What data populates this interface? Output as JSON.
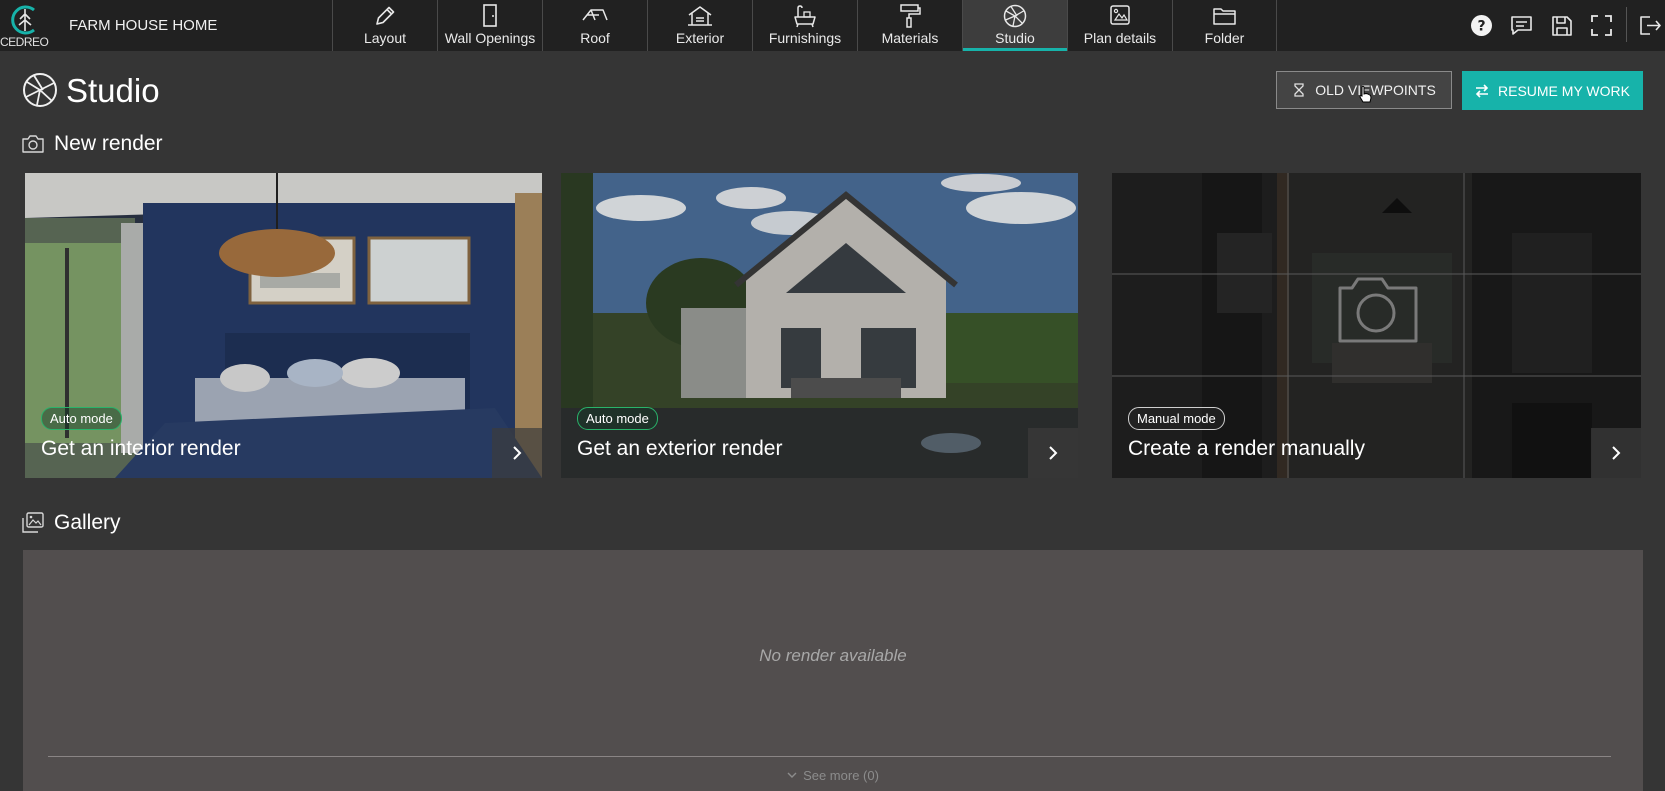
{
  "app": {
    "logo_text": "CEDREO",
    "project_name": "FARM HOUSE HOME"
  },
  "nav": {
    "tabs": [
      {
        "label": "Layout",
        "icon": "pencil-icon"
      },
      {
        "label": "Wall Openings",
        "icon": "door-icon"
      },
      {
        "label": "Roof",
        "icon": "roof-icon"
      },
      {
        "label": "Exterior",
        "icon": "house-exterior-icon"
      },
      {
        "label": "Furnishings",
        "icon": "bathtub-icon"
      },
      {
        "label": "Materials",
        "icon": "paint-roller-icon"
      },
      {
        "label": "Studio",
        "icon": "aperture-icon",
        "active": true
      },
      {
        "label": "Plan details",
        "icon": "tag-icon"
      },
      {
        "label": "Folder",
        "icon": "folder-icon"
      }
    ],
    "right_icons": [
      "help-icon",
      "chat-icon",
      "save-icon",
      "fullscreen-icon",
      "logout-icon"
    ]
  },
  "header": {
    "title": "Studio",
    "old_viewpoints_label": "OLD VIEWPOINTS",
    "resume_label": "RESUME MY WORK"
  },
  "new_render": {
    "title": "New render",
    "cards": [
      {
        "badge": "Auto mode",
        "title": "Get an interior render"
      },
      {
        "badge": "Auto mode",
        "title": "Get an exterior render"
      },
      {
        "badge": "Manual mode",
        "title": "Create a render manually"
      }
    ]
  },
  "gallery": {
    "title": "Gallery",
    "empty_message": "No render available",
    "see_more_label": "See more (0)"
  },
  "colors": {
    "accent": "#17b3aa",
    "topbar": "#212121",
    "background": "#353535",
    "auto_badge_border": "#29b36a",
    "gallery_bg": "#524e4e"
  }
}
